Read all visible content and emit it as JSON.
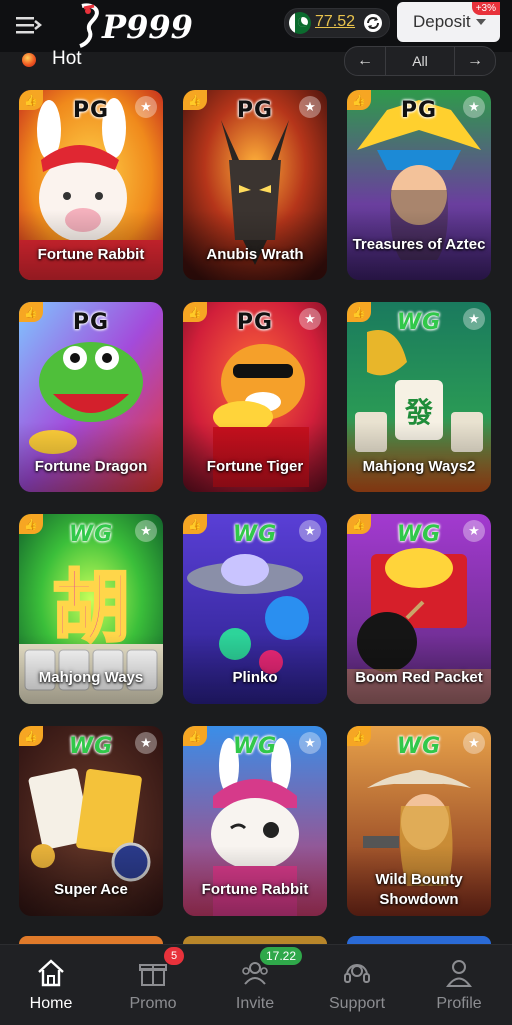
{
  "header": {
    "logo_text": "P999",
    "balance": "77.52",
    "deposit_label": "Deposit",
    "bonus_badge": "+3%"
  },
  "section": {
    "title": "Hot",
    "pager_prev": "←",
    "pager_all": "All",
    "pager_next": "→"
  },
  "games": [
    {
      "title": "Fortune Rabbit",
      "provider": "PG"
    },
    {
      "title": "Anubis Wrath",
      "provider": "PG"
    },
    {
      "title": "Treasures of Aztec",
      "provider": "PG"
    },
    {
      "title": "Fortune Dragon",
      "provider": "PG"
    },
    {
      "title": "Fortune Tiger",
      "provider": "PG"
    },
    {
      "title": "Mahjong Ways2",
      "provider": "WG"
    },
    {
      "title": "Mahjong Ways",
      "provider": "WG"
    },
    {
      "title": "Plinko",
      "provider": "WG"
    },
    {
      "title": "Boom Red Packet",
      "provider": "WG"
    },
    {
      "title": "Super Ace",
      "provider": "WG"
    },
    {
      "title": "Fortune Rabbit",
      "provider": "WG"
    },
    {
      "title": "Wild Bounty Showdown",
      "provider": "WG"
    }
  ],
  "nav": [
    {
      "label": "Home",
      "icon": "home-icon"
    },
    {
      "label": "Promo",
      "icon": "gift-icon",
      "badge": "5"
    },
    {
      "label": "Invite",
      "icon": "invite-icon",
      "badge": "17.22"
    },
    {
      "label": "Support",
      "icon": "headset-icon"
    },
    {
      "label": "Profile",
      "icon": "user-icon"
    }
  ],
  "colors": {
    "background": "#1b1c1e",
    "balance_text": "#e9c34d",
    "badge_red": "#e8323b",
    "badge_green": "#2fa84a",
    "thumb_badge": "#f6a623"
  }
}
